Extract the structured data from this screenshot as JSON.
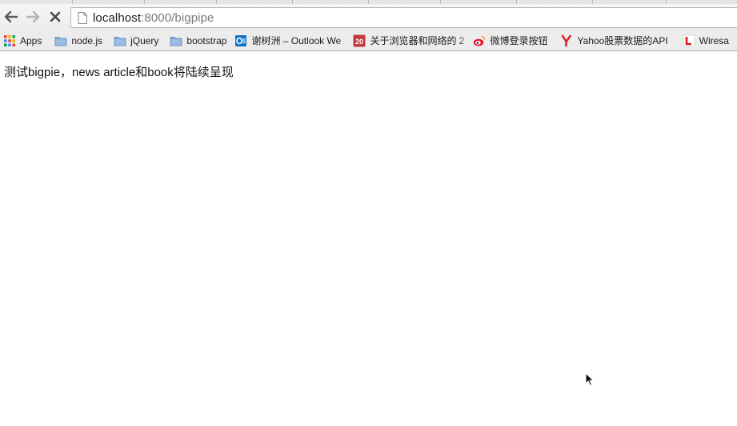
{
  "browser": {
    "address_bar": {
      "host": "localhost",
      "rest": ":8000/bigpipe"
    }
  },
  "bookmarks": {
    "items": [
      {
        "label": "Apps",
        "icon": "apps-grid-icon"
      },
      {
        "label": "node.js",
        "icon": "folder-icon"
      },
      {
        "label": "jQuery",
        "icon": "folder-icon"
      },
      {
        "label": "bootstrap",
        "icon": "folder-icon"
      },
      {
        "label": "谢树洲 – Outlook We",
        "icon": "outlook-icon"
      },
      {
        "label": "关于浏览器和网络的 2",
        "icon": "calendar-icon",
        "icon_text": "20"
      },
      {
        "label": "微博登录按钮",
        "icon": "weibo-icon"
      },
      {
        "label": "Yahoo股票数据的API",
        "icon": "yahoo-icon"
      },
      {
        "label": "Wiresa",
        "icon": "l-logo-icon"
      }
    ]
  },
  "page": {
    "text": "测试bigpie，news article和book将陆续呈现"
  },
  "colors": {
    "toolbar": "#ececec",
    "folder": "#7ea6d3",
    "outlook": "#0b6fc4",
    "calendar": "#c4383b",
    "weibo": "#e6162d"
  }
}
